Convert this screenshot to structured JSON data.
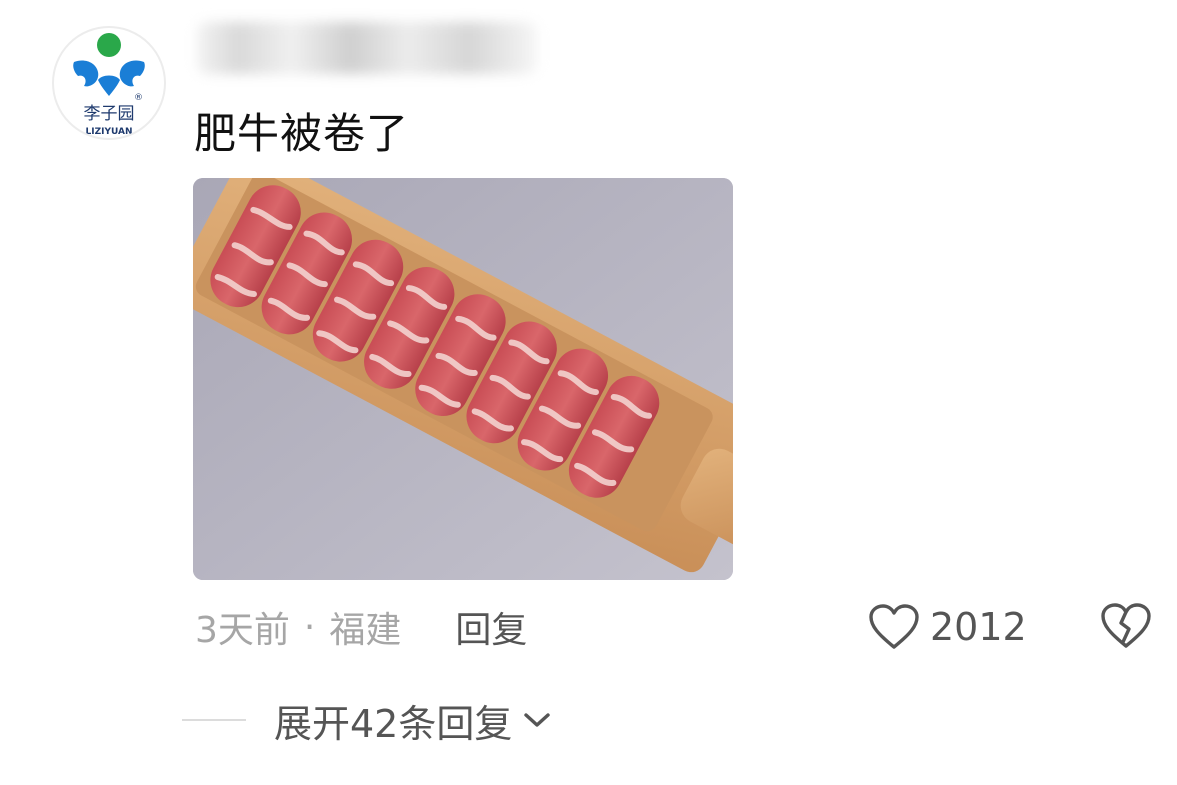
{
  "comment": {
    "avatar": {
      "brand_name": "李子园",
      "brand_latin": "LIZIYUAN",
      "registered_mark": "®",
      "colors": {
        "green": "#2aa84a",
        "blue": "#1a7ed6",
        "text": "#1e3a6e"
      }
    },
    "username": "",
    "text": "肥牛被卷了",
    "image": {
      "subject": "beef-rolls-on-wooden-board",
      "colors": {
        "background": "#b4b2c0",
        "board": "#d4a06a",
        "meat": "#c2484f",
        "fat": "#f3d2cf"
      }
    },
    "meta": {
      "time": "3天前",
      "separator": "·",
      "location": "福建",
      "reply_label": "回复"
    },
    "likes": {
      "icon": "heart-outline-icon",
      "count": "2012"
    },
    "dislike": {
      "icon": "broken-heart-icon"
    },
    "expand": {
      "label": "展开42条回复",
      "icon": "chevron-down-icon"
    }
  }
}
